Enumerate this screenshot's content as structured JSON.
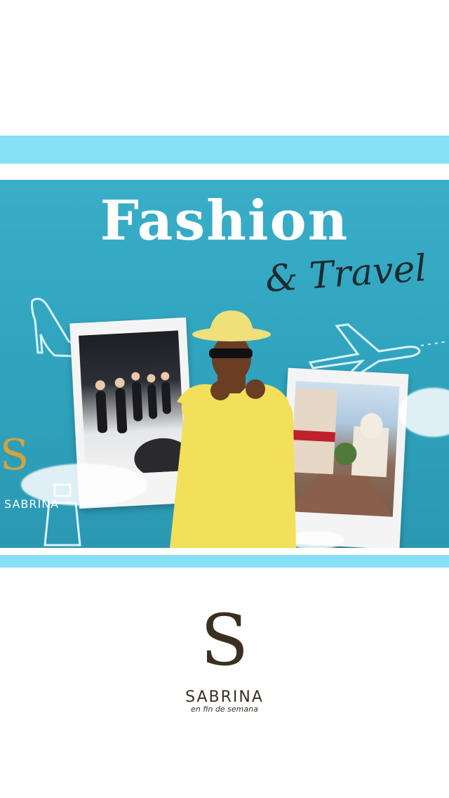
{
  "post": {
    "title_main": "Fashion",
    "title_script": "& Travel",
    "accent_color": "#86e0f6",
    "panel_color": "#35a8c2",
    "icons": [
      "high-heel-icon",
      "airplane-icon",
      "perfume-bottle-icon"
    ]
  },
  "watermark": {
    "letter": "S",
    "name": "SABRINA"
  },
  "brand": {
    "letter": "S",
    "name": "SABRINA",
    "tagline": "en fin de semana",
    "color": "#3b2f22"
  }
}
